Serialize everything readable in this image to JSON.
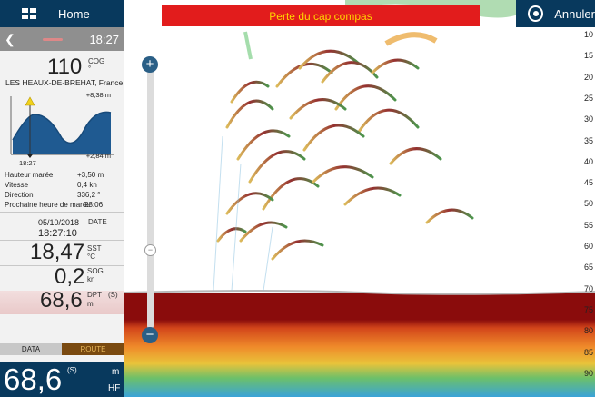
{
  "header": {
    "home_label": "Home",
    "alert_text": "Perte du cap compas",
    "cancel_label": "Annuler"
  },
  "panel": {
    "time": "18:27",
    "cog": {
      "value": "110",
      "label": "COG",
      "unit": "°"
    },
    "location": "LES HEAUX-DE-BREHAT, France",
    "tide": {
      "max": "+8,38 m",
      "min": "+2,84 m",
      "time": "18:27"
    },
    "info": [
      {
        "label": "Hauteur marée",
        "value": "+3,50 m"
      },
      {
        "label": "Vitesse",
        "value": "0,4 kn"
      },
      {
        "label": "Direction",
        "value": "336,2 °"
      },
      {
        "label": "Prochaine heure de marée",
        "value": "23:06"
      }
    ],
    "date": "05/10/2018",
    "date_label": "DATE",
    "clock": "18:27:10",
    "sst": {
      "value": "18,47",
      "label": "SST",
      "unit": "°C"
    },
    "sog": {
      "value": "0,2",
      "label": "SOG",
      "unit": "kn"
    },
    "dpt": {
      "value": "68,6",
      "label": "DPT",
      "unit": "m",
      "source": "(S)"
    },
    "tabs": {
      "data": "DATA",
      "route": "ROUTE"
    },
    "bottom": {
      "value": "68,6",
      "source": "(S)",
      "unit": "m",
      "freq": "HF"
    }
  },
  "zoom": {
    "plus": "+",
    "minus": "−",
    "handle": "−"
  },
  "depth_scale": [
    "10",
    "15",
    "20",
    "25",
    "30",
    "35",
    "40",
    "45",
    "50",
    "55",
    "60",
    "65",
    "70",
    "75",
    "80",
    "85",
    "90"
  ],
  "colors": {
    "nav_blue": "#08395d",
    "alert_red": "#e21c1c",
    "alert_text": "#ffd400",
    "seabed": "#7a0a0a"
  }
}
